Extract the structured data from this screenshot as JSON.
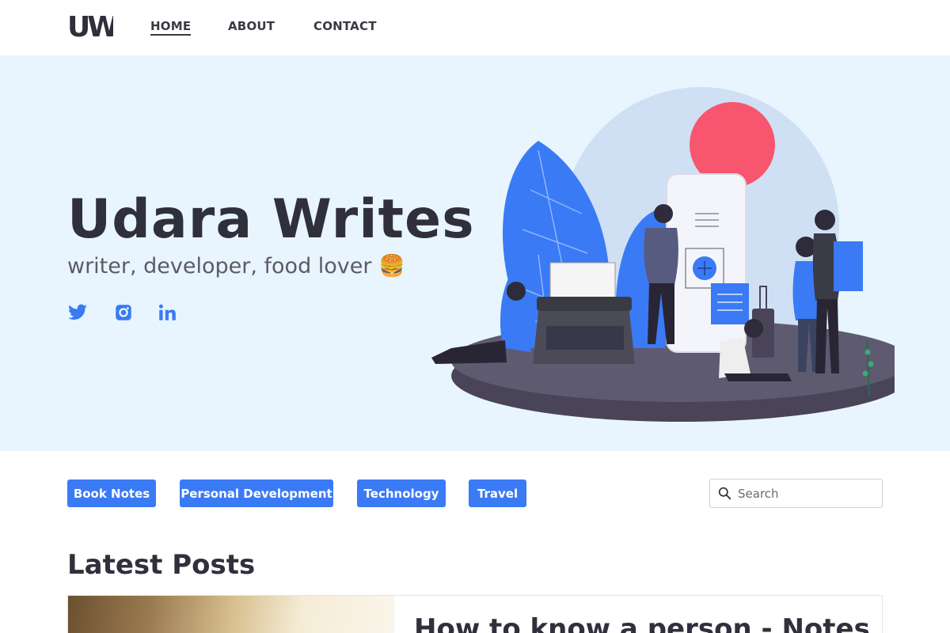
{
  "header": {
    "logo_text": "UW",
    "nav": [
      {
        "label": "HOME",
        "active": true
      },
      {
        "label": "ABOUT",
        "active": false
      },
      {
        "label": "CONTACT",
        "active": false
      }
    ]
  },
  "hero": {
    "title": "Udara Writes",
    "subtitle": "writer, developer, food lover 🍔",
    "social": [
      {
        "icon": "twitter-icon",
        "color": "#3a7af5"
      },
      {
        "icon": "instagram-icon",
        "color": "#3a7af5"
      },
      {
        "icon": "linkedin-icon",
        "color": "#3a7af5"
      }
    ],
    "background_color": "#e8f5fe"
  },
  "categories": [
    "Book Notes",
    "Personal Development",
    "Technology",
    "Travel"
  ],
  "search": {
    "placeholder": "Search"
  },
  "latest": {
    "heading": "Latest Posts",
    "posts": [
      {
        "title": "How to know a person - Notes"
      }
    ]
  },
  "colors": {
    "accent": "#3a7af5",
    "text": "#30303d"
  }
}
